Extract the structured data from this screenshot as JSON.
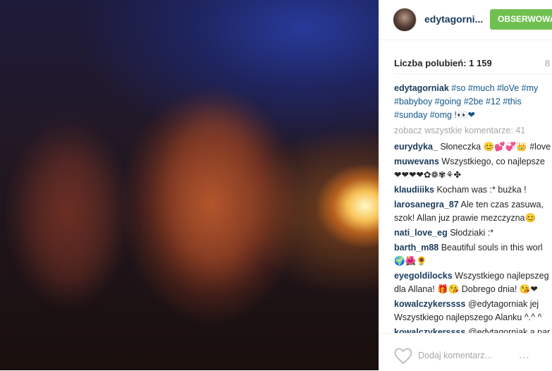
{
  "post": {
    "photo_alt": "photo",
    "username": "edytagorni...",
    "follow_label": "OBSERWOWA",
    "likes": "Liczba polubień: 1 159",
    "time": "8"
  },
  "caption": {
    "user": "edytagorniak",
    "text": "#so #much #loVe #my\n#babyboy #going #2be #12 #this\n#sunday #omg !👀❤"
  },
  "view_all": "zobacz wszystkie komentarze: 41",
  "comments": [
    {
      "user": "eurydyka_",
      "text": "Słoneczka 😊💕💞👑 #love"
    },
    {
      "user": "muwevans",
      "text": "Wszystkiego, co najlepsze\n❤❤❤❤✿❁✾⚘✤"
    },
    {
      "user": "klaudiiiks",
      "text": "Kocham was :* bużka !"
    },
    {
      "user": "larosanegra_87",
      "text": "Ale ten czas zasuwa,\nszok! Allan juz prawie mezczyzna😊"
    },
    {
      "user": "nati_love_eg",
      "text": "Słodziaki :*"
    },
    {
      "user": "barth_m88",
      "text": "Beautiful souls in this worl\n🌍🌺🌻"
    },
    {
      "user": "eyegoldilocks",
      "text": "Wszystkiego najlepszeg\ndla Allana! 🎁😘 Dobrego dnia! 😘❤"
    },
    {
      "user": "kowalczykerssss",
      "text": "@edytagorniak jej\nWszystkiego najlepszego Alanku ^.^ ^"
    },
    {
      "user": "kowalczykerssss",
      "text": "@edytagorniak a par"
    }
  ],
  "add_comment_placeholder": "Dodaj komentarz...",
  "more_label": "...",
  "colors": {
    "follow": "#70c050",
    "link": "#125688",
    "username": "#1a3a5c"
  }
}
